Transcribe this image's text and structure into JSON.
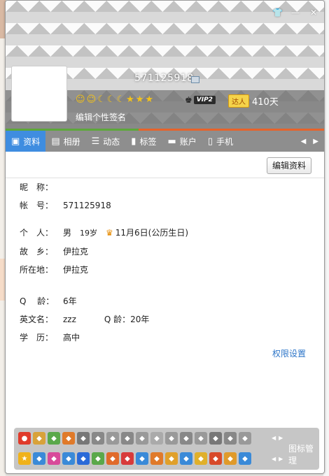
{
  "window": {
    "controls": [
      "shirt-icon",
      "minimize-icon",
      "close-icon"
    ]
  },
  "profile": {
    "uid": "571125918",
    "signature": "编辑个性签名",
    "vip_label": "VIP2",
    "daren_label": "达人",
    "days": "410天"
  },
  "tabs": [
    {
      "label": "资料",
      "icon": "id-card-icon"
    },
    {
      "label": "相册",
      "icon": "photo-icon"
    },
    {
      "label": "动态",
      "icon": "feed-icon"
    },
    {
      "label": "标签",
      "icon": "bookmark-icon"
    },
    {
      "label": "账户",
      "icon": "wallet-icon"
    },
    {
      "label": "手机",
      "icon": "phone-icon"
    }
  ],
  "edit_button": "编辑资料",
  "fields": {
    "nickname_label": "昵　称：",
    "nickname_value": "",
    "account_label": "帐　号：",
    "account_value": "571125918",
    "personal_label": "个　人：",
    "gender": "男",
    "age": "19岁",
    "birthday": "11月6日(公历生日)",
    "hometown_label": "故　乡：",
    "hometown_value": "伊拉克",
    "location_label": "所在地：",
    "location_value": "伊拉克",
    "qage_label": "Q　 龄：",
    "qage_value": "6年",
    "english_label": "英文名：",
    "english_value": "zzz",
    "qage2": "Q 龄：20年",
    "education_label": "学　历：",
    "education_value": "高中"
  },
  "permission_link": "权限设置",
  "icon_manager": "图标管理",
  "colors": {
    "tab_active": "#3f8de0",
    "tab_bar": "#8e8e8e",
    "link": "#2d75c8",
    "green_line": "#5da83a",
    "orange_line": "#e8632a"
  }
}
